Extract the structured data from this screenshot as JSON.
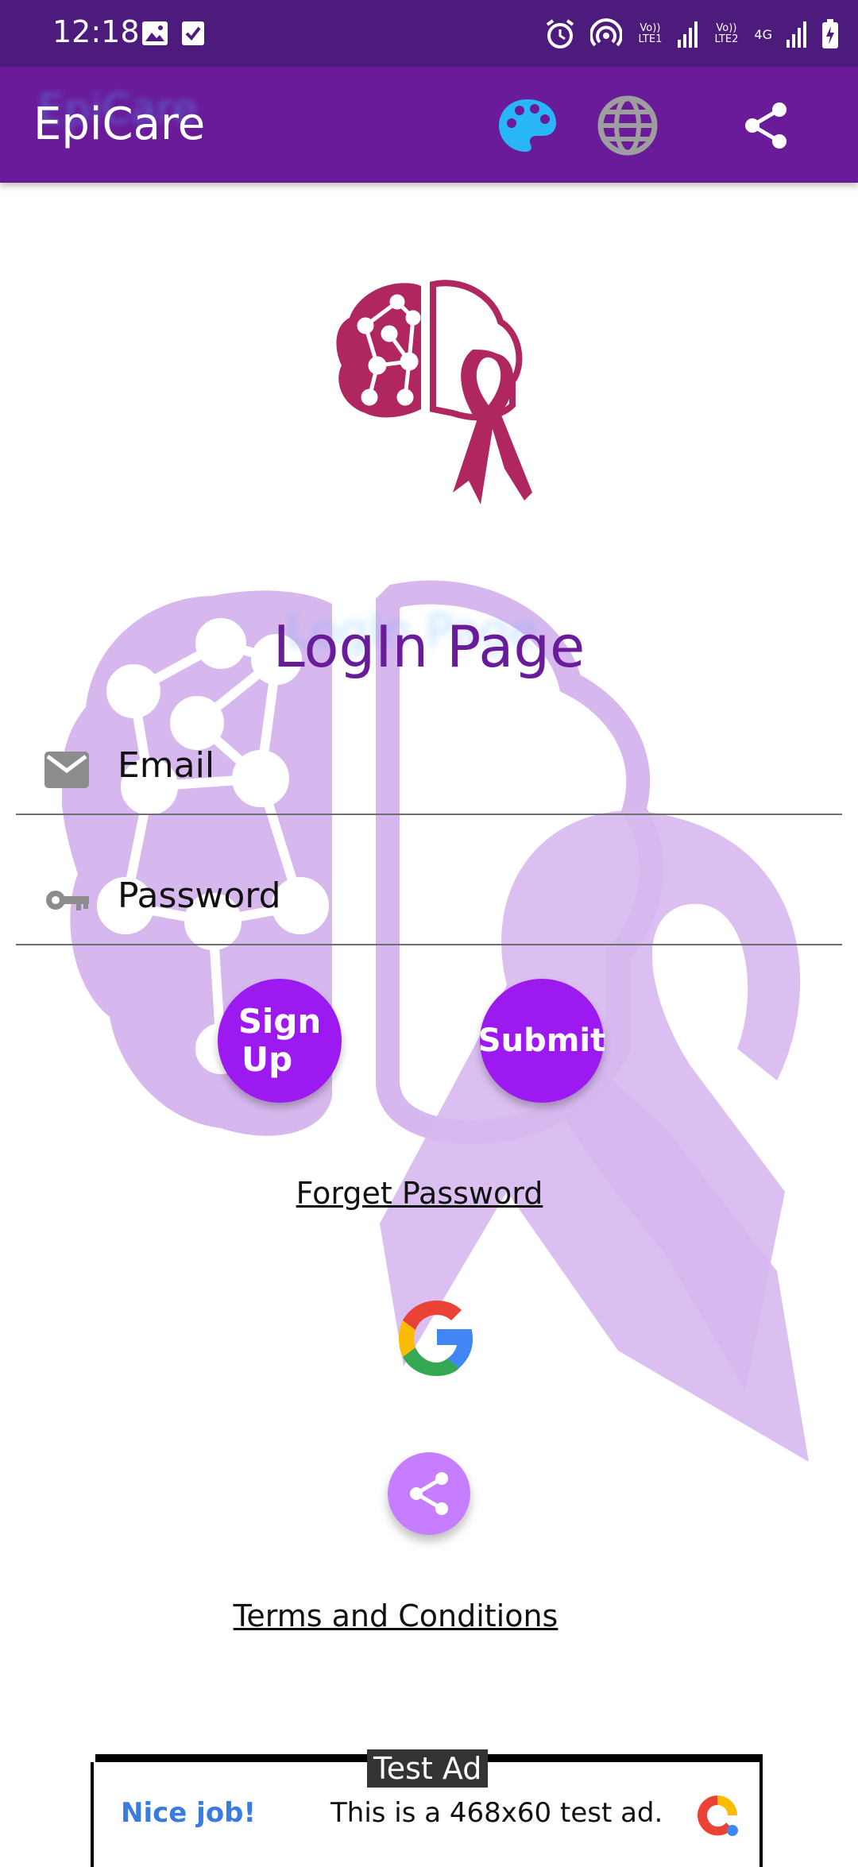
{
  "status_bar": {
    "time": "12:18",
    "sim1": "Vo)) LTE1",
    "sim2": "Vo)) LTE2",
    "network": "4G"
  },
  "app_bar": {
    "title": "EpiCare",
    "icons": [
      "palette-icon",
      "globe-icon",
      "share-icon"
    ],
    "palette_color": "#29b6f6"
  },
  "login": {
    "title": "LogIn Page",
    "email_placeholder": "Email",
    "password_placeholder": "Password",
    "signup_label_line1": "Sign",
    "signup_label_line2": "Up",
    "submit_label": "Submit",
    "forget_password": "Forget Password",
    "terms": "Terms and Conditions"
  },
  "colors": {
    "status_bar": "#4c1b7b",
    "app_bar": "#6a1b9a",
    "accent_button": "#9c19ef",
    "share_fab": "#c77dff",
    "logo": "#b0275f",
    "watermark": "#d5b5ee"
  },
  "ad": {
    "badge": "Test Ad",
    "headline": "Nice job!",
    "body": "This is a 468x60 test ad."
  }
}
